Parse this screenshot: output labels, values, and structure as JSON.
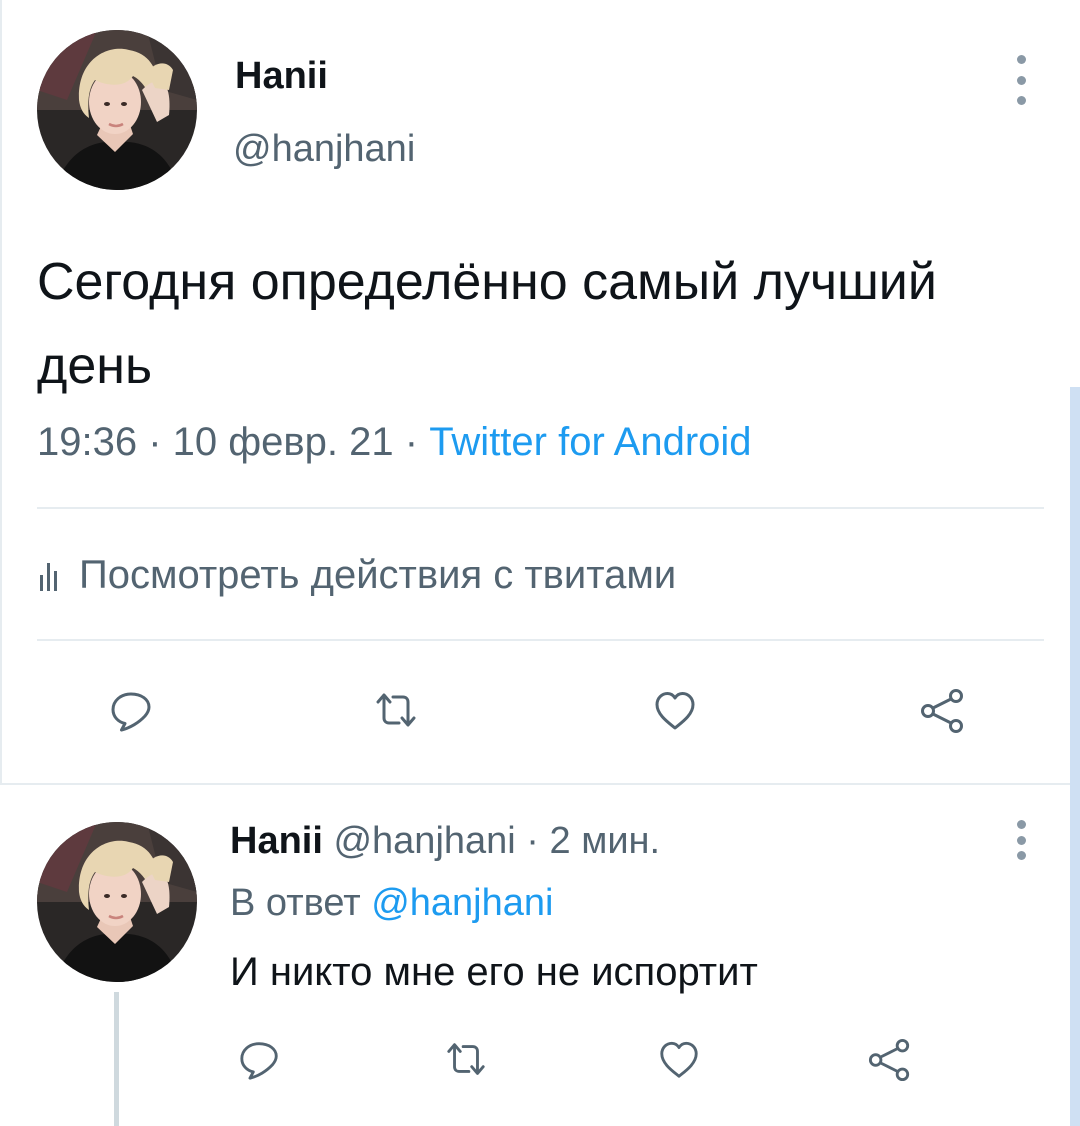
{
  "colors": {
    "accent": "#1d9bf0",
    "secondary_text": "#536471",
    "icon": "#536471",
    "divider": "#e6ecf0"
  },
  "tweet": {
    "author_name": "Hanii",
    "author_handle": "@hanjhani",
    "text": "Сегодня определённо самый лучший день",
    "time": "19:36",
    "date": "10 февр. 21",
    "separator": " · ",
    "source": "Twitter for Android",
    "activity_label": "Посмотреть действия с твитами",
    "actions": [
      "reply-icon",
      "retweet-icon",
      "like-icon",
      "share-icon"
    ]
  },
  "reply": {
    "author_name": "Hanii",
    "author_handle": "@hanjhani",
    "time_ago": "2 мин.",
    "separator": " · ",
    "reply_prefix": "В ответ ",
    "reply_mention": "@hanjhani",
    "text": "И никто мне его не испортит",
    "actions": [
      "reply-icon",
      "retweet-icon",
      "like-icon",
      "share-icon"
    ]
  }
}
